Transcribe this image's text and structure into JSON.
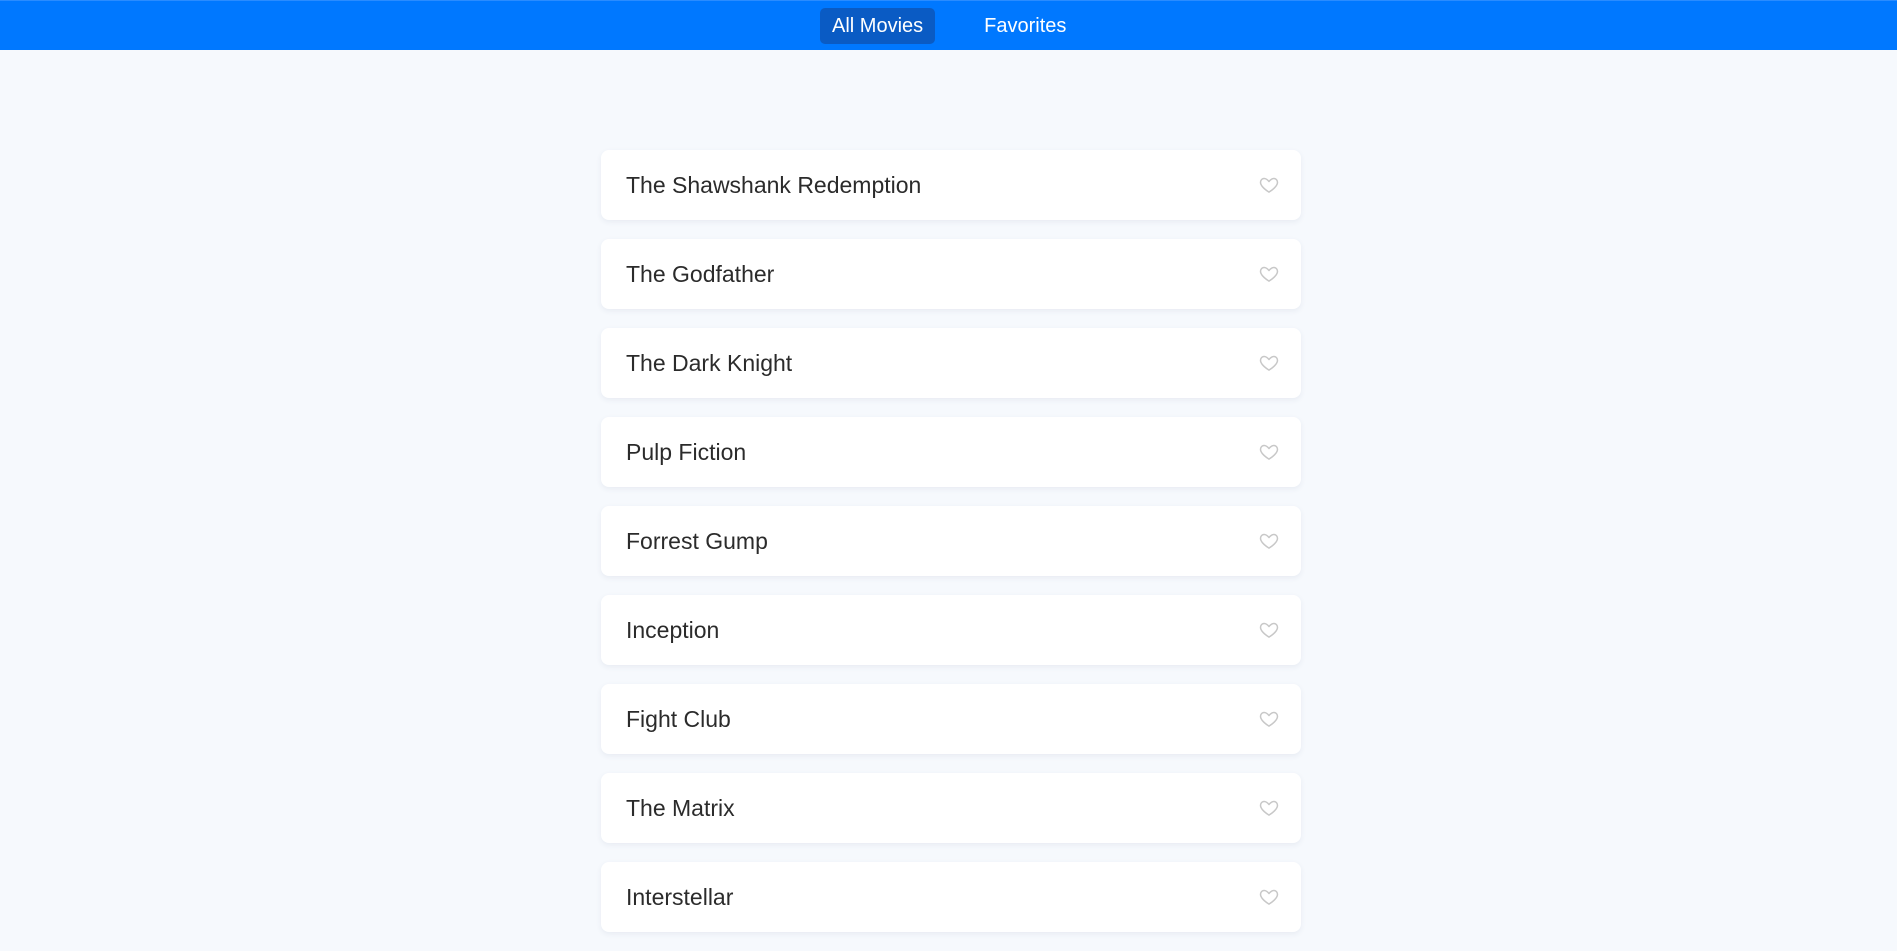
{
  "nav": {
    "all_movies_label": "All Movies",
    "favorites_label": "Favorites",
    "active_tab": "All Movies"
  },
  "colors": {
    "header": "#0078ff",
    "active_tab": "#0a5bc4",
    "background": "#f6f9fd",
    "card": "#ffffff",
    "heart_outline": "#c8c8c8"
  },
  "movies": [
    {
      "title": "The Shawshank Redemption",
      "favorite": false,
      "icon": "heart-outline-icon"
    },
    {
      "title": "The Godfather",
      "favorite": false,
      "icon": "heart-outline-icon"
    },
    {
      "title": "The Dark Knight",
      "favorite": false,
      "icon": "heart-outline-icon"
    },
    {
      "title": "Pulp Fiction",
      "favorite": false,
      "icon": "heart-outline-icon"
    },
    {
      "title": "Forrest Gump",
      "favorite": false,
      "icon": "heart-outline-icon"
    },
    {
      "title": "Inception",
      "favorite": false,
      "icon": "heart-outline-icon"
    },
    {
      "title": "Fight Club",
      "favorite": false,
      "icon": "heart-outline-icon"
    },
    {
      "title": "The Matrix",
      "favorite": false,
      "icon": "heart-outline-icon"
    },
    {
      "title": "Interstellar",
      "favorite": false,
      "icon": "heart-outline-icon"
    }
  ]
}
